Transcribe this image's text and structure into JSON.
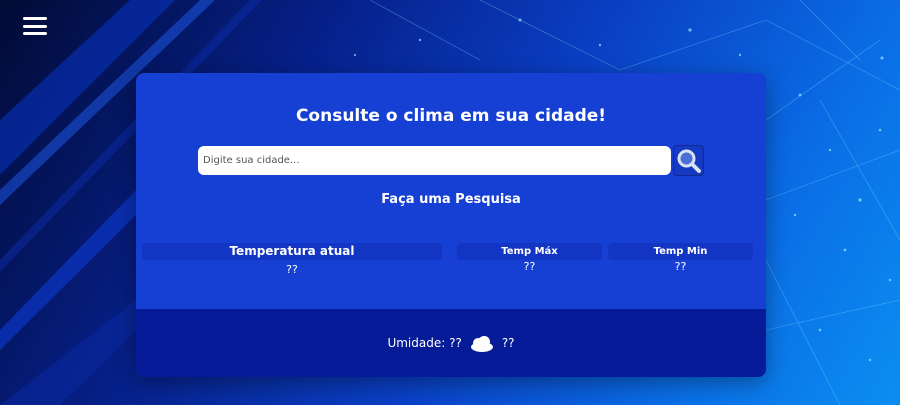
{
  "menu": {
    "icon": "hamburger-menu-icon"
  },
  "card": {
    "title": "Consulte o clima em sua cidade!",
    "search": {
      "placeholder": "Digite sua cidade...",
      "value": "",
      "button_icon": "search-icon"
    },
    "subtitle": "Faça uma Pesquisa",
    "current_temp": {
      "label": "Temperatura atual",
      "value": "??"
    },
    "temp_max": {
      "label": "Temp Máx",
      "value": "??"
    },
    "temp_min": {
      "label": "Temp Min",
      "value": "??"
    },
    "humidity": {
      "label": "Umidade: ??",
      "weather_icon": "cloud-icon",
      "value": "??"
    }
  },
  "colors": {
    "card_bg": "#1640d4",
    "footer_bg": "#051b98",
    "label_bg": "#1335c4",
    "text": "#ffffff"
  }
}
